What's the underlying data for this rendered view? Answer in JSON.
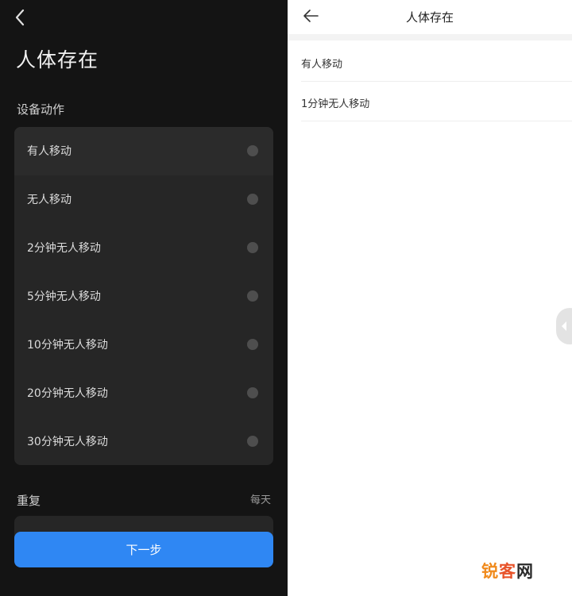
{
  "left": {
    "title": "人体存在",
    "section_label": "设备动作",
    "options": [
      {
        "label": "有人移动"
      },
      {
        "label": "无人移动"
      },
      {
        "label": "2分钟无人移动"
      },
      {
        "label": "5分钟无人移动"
      },
      {
        "label": "10分钟无人移动"
      },
      {
        "label": "20分钟无人移动"
      },
      {
        "label": "30分钟无人移动"
      }
    ],
    "repeat_label": "重复",
    "repeat_value": "每天",
    "next_label": "下一步"
  },
  "right": {
    "title": "人体存在",
    "items": [
      {
        "label": "有人移动"
      },
      {
        "label": "1分钟无人移动"
      }
    ]
  },
  "watermark": {
    "part1": "锐",
    "part2": "客",
    "part3": "网"
  },
  "colors": {
    "accent": "#2f87f3",
    "dark_bg": "#141414",
    "card_bg": "#262626"
  }
}
